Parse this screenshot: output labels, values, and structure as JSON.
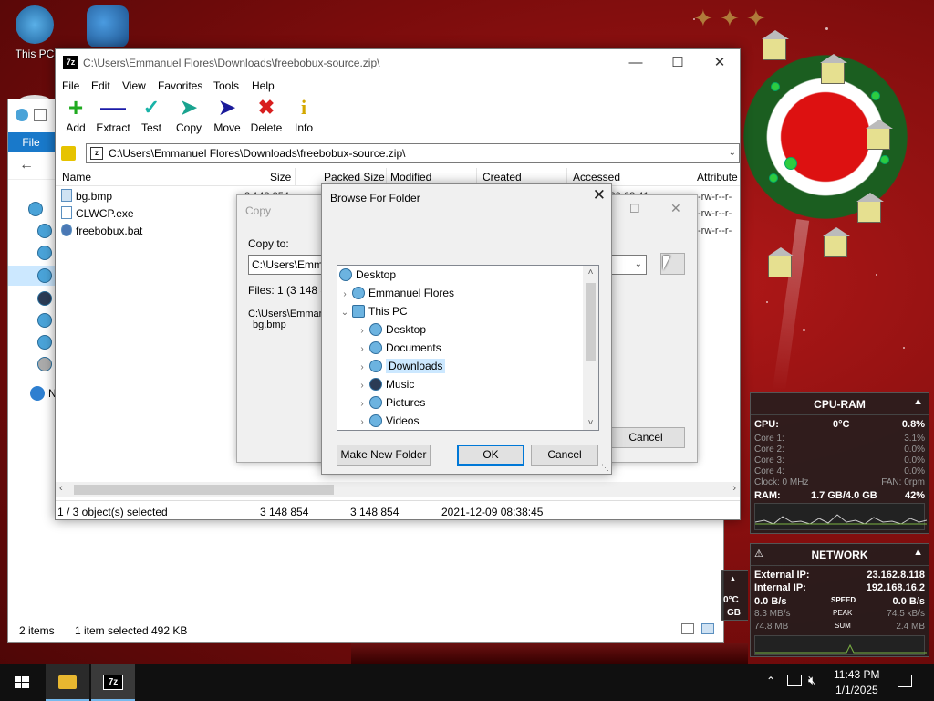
{
  "desktop": {
    "icons": [
      {
        "label": "This PC"
      }
    ]
  },
  "explorer": {
    "file_tab": "File",
    "nav_partial": "N",
    "status": {
      "items": "2 items",
      "selected": "1 item selected",
      "size": "492 KB"
    }
  },
  "zip": {
    "title": "C:\\Users\\Emmanuel Flores\\Downloads\\freebobux-source.zip\\",
    "menu": [
      "File",
      "Edit",
      "View",
      "Favorites",
      "Tools",
      "Help"
    ],
    "toolbar": [
      {
        "label": "Add",
        "icon": "plus-icon",
        "color": "#1faa1f"
      },
      {
        "label": "Extract",
        "icon": "minus-icon",
        "color": "#1a1aa8"
      },
      {
        "label": "Test",
        "icon": "check-icon",
        "color": "#19b3a8"
      },
      {
        "label": "Copy",
        "icon": "arrow-right-double-icon",
        "color": "#19a38f"
      },
      {
        "label": "Move",
        "icon": "arrow-right-icon",
        "color": "#1a1a9a"
      },
      {
        "label": "Delete",
        "icon": "x-icon",
        "color": "#d81e1e"
      },
      {
        "label": "Info",
        "icon": "info-icon",
        "color": "#d4a800"
      }
    ],
    "address": "C:\\Users\\Emmanuel Flores\\Downloads\\freebobux-source.zip\\",
    "columns": [
      "Name",
      "Size",
      "Packed Size",
      "Modified",
      "Created",
      "Accessed",
      "Attribute"
    ],
    "files": [
      {
        "name": "bg.bmp",
        "size": "3 148 854",
        "accessed": "-09 08:41",
        "attr": "-rw-r--r-"
      },
      {
        "name": "CLWCP.exe",
        "attr": "-rw-r--r-"
      },
      {
        "name": "freebobux.bat",
        "attr": "-rw-r--r-"
      }
    ],
    "status": {
      "selected": "1 / 3 object(s) selected",
      "size": "3 148 854",
      "packed": "3 148 854",
      "modified": "2021-12-09 08:38:45"
    }
  },
  "copy_dialog": {
    "title": "Copy",
    "copy_to_label": "Copy to:",
    "path_value": "C:\\Users\\Emmanuel Flores\\Downloads\\",
    "files_info": "Files: 1    (3 148 854 bytes)",
    "source_path": "C:\\Users\\Emmanuel Flores\\Downloads\\freebobux-source.zip\\",
    "source_file": "bg.bmp",
    "cancel": "Cancel"
  },
  "browse_dialog": {
    "title": "Browse For Folder",
    "tree": [
      {
        "label": "Desktop",
        "level": 0,
        "chevron": ""
      },
      {
        "label": "Emmanuel Flores",
        "level": 1,
        "chevron": "›"
      },
      {
        "label": "This PC",
        "level": 1,
        "chevron": "⌄"
      },
      {
        "label": "Desktop",
        "level": 2,
        "chevron": "›"
      },
      {
        "label": "Documents",
        "level": 2,
        "chevron": "›"
      },
      {
        "label": "Downloads",
        "level": 2,
        "chevron": "›",
        "selected": true
      },
      {
        "label": "Music",
        "level": 2,
        "chevron": "›"
      },
      {
        "label": "Pictures",
        "level": 2,
        "chevron": "›"
      },
      {
        "label": "Videos",
        "level": 2,
        "chevron": "›"
      }
    ],
    "make_new_folder": "Make New Folder",
    "ok": "OK",
    "cancel": "Cancel"
  },
  "cpu_gadget": {
    "title": "CPU-RAM",
    "cpu_label": "CPU:",
    "temp": "0°C",
    "cpu_pct": "0.8%",
    "cores": [
      {
        "label": "Core 1:",
        "value": "3.1%"
      },
      {
        "label": "Core 2:",
        "value": "0.0%"
      },
      {
        "label": "Core 3:",
        "value": "0.0%"
      },
      {
        "label": "Core 4:",
        "value": "0.0%"
      }
    ],
    "clock": "Clock: 0 MHz",
    "fan": "FAN: 0rpm",
    "ram_label": "RAM:",
    "ram_value": "1.7 GB/4.0 GB",
    "ram_pct": "42%"
  },
  "network_gadget": {
    "title": "NETWORK",
    "external_label": "External IP:",
    "external_ip": "23.162.8.118",
    "internal_label": "Internal IP:",
    "internal_ip": "192.168.16.2",
    "down_speed": "0.0 B/s",
    "speed_label": "SPEED",
    "up_speed": "0.0 B/s",
    "down_peak": "8.3 MB/s",
    "peak_label": "PEAK",
    "up_peak": "74.5 kB/s",
    "down_sum": "74.8 MB",
    "sum_label": "SUM",
    "up_sum": "2.4 MB"
  },
  "partial_gadget": {
    "temp": "0°C",
    "unit": "GB"
  },
  "taskbar": {
    "time": "11:43 PM",
    "date": "1/1/2025"
  }
}
